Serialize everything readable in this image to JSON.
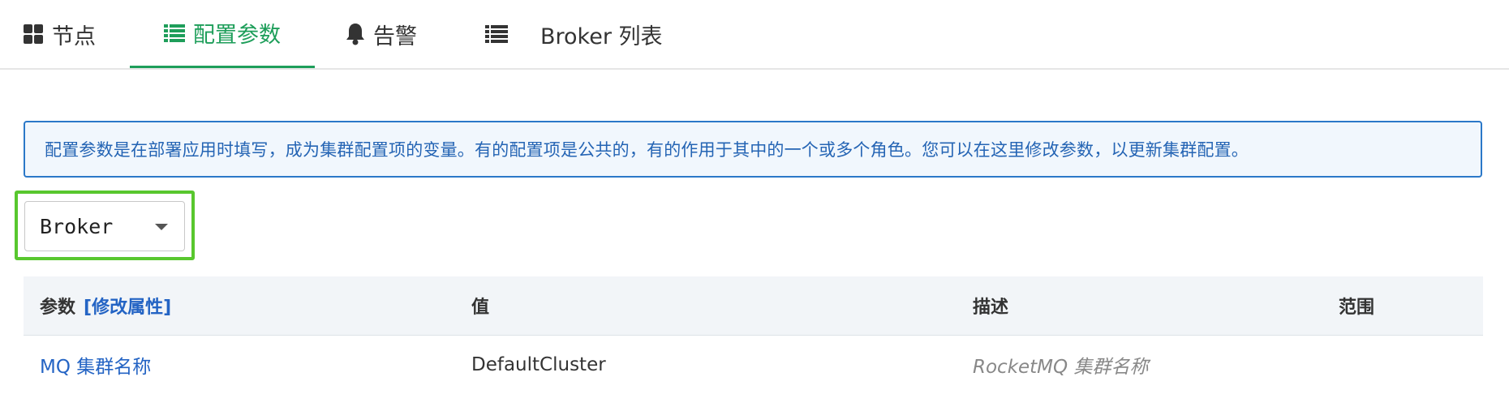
{
  "tabs": [
    {
      "label": "节点",
      "icon": "grid-icon",
      "active": false
    },
    {
      "label": "配置参数",
      "icon": "list-icon",
      "active": true
    },
    {
      "label": "告警",
      "icon": "bell-icon",
      "active": false
    },
    {
      "label": "Broker 列表",
      "icon": "list-icon",
      "active": false
    }
  ],
  "info": {
    "text": "配置参数是在部署应用时填写，成为集群配置项的变量。有的配置项是公共的，有的作用于其中的一个或多个角色。您可以在这里修改参数，以更新集群配置。"
  },
  "role_select": {
    "value": "Broker"
  },
  "table": {
    "headers": {
      "param": "参数",
      "edit_link": "[修改属性]",
      "value": "值",
      "description": "描述",
      "scope": "范围"
    },
    "rows": [
      {
        "name": "MQ 集群名称",
        "value": "DefaultCluster",
        "description": "RocketMQ 集群名称",
        "scope": ""
      }
    ]
  },
  "colors": {
    "accent": "#1e9e5a",
    "info_border": "#2b78c8",
    "link": "#2464c4",
    "highlight": "#58c72e"
  }
}
